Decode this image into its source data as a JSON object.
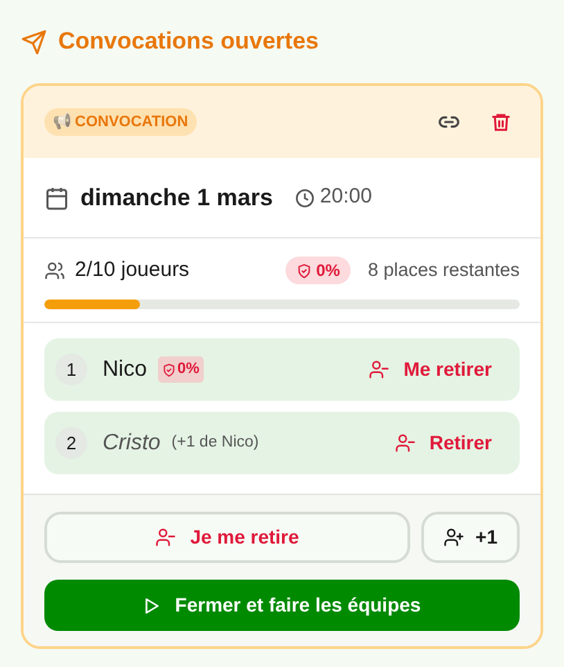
{
  "section_title": "Convocations ouvertes",
  "card": {
    "badge": {
      "emoji": "📢",
      "label": "CONVOCATION"
    },
    "date": "dimanche 1 mars",
    "time": "20:00",
    "players_count": "2/10 joueurs",
    "shield_badge": "0%",
    "remaining": "8 places restantes",
    "progress": {
      "level": 0.2
    },
    "players": [
      {
        "kind": "member",
        "number": "1",
        "name": "Nico",
        "badge": "0%",
        "action": "Me retirer"
      },
      {
        "kind": "guest",
        "number": "2",
        "name": "Cristo",
        "note": "(+1 de Nico)",
        "action": "Retirer"
      }
    ],
    "leave_button": "Je me retire",
    "plus_one_button": "+1",
    "close_button": "Fermer et faire les équipes"
  }
}
